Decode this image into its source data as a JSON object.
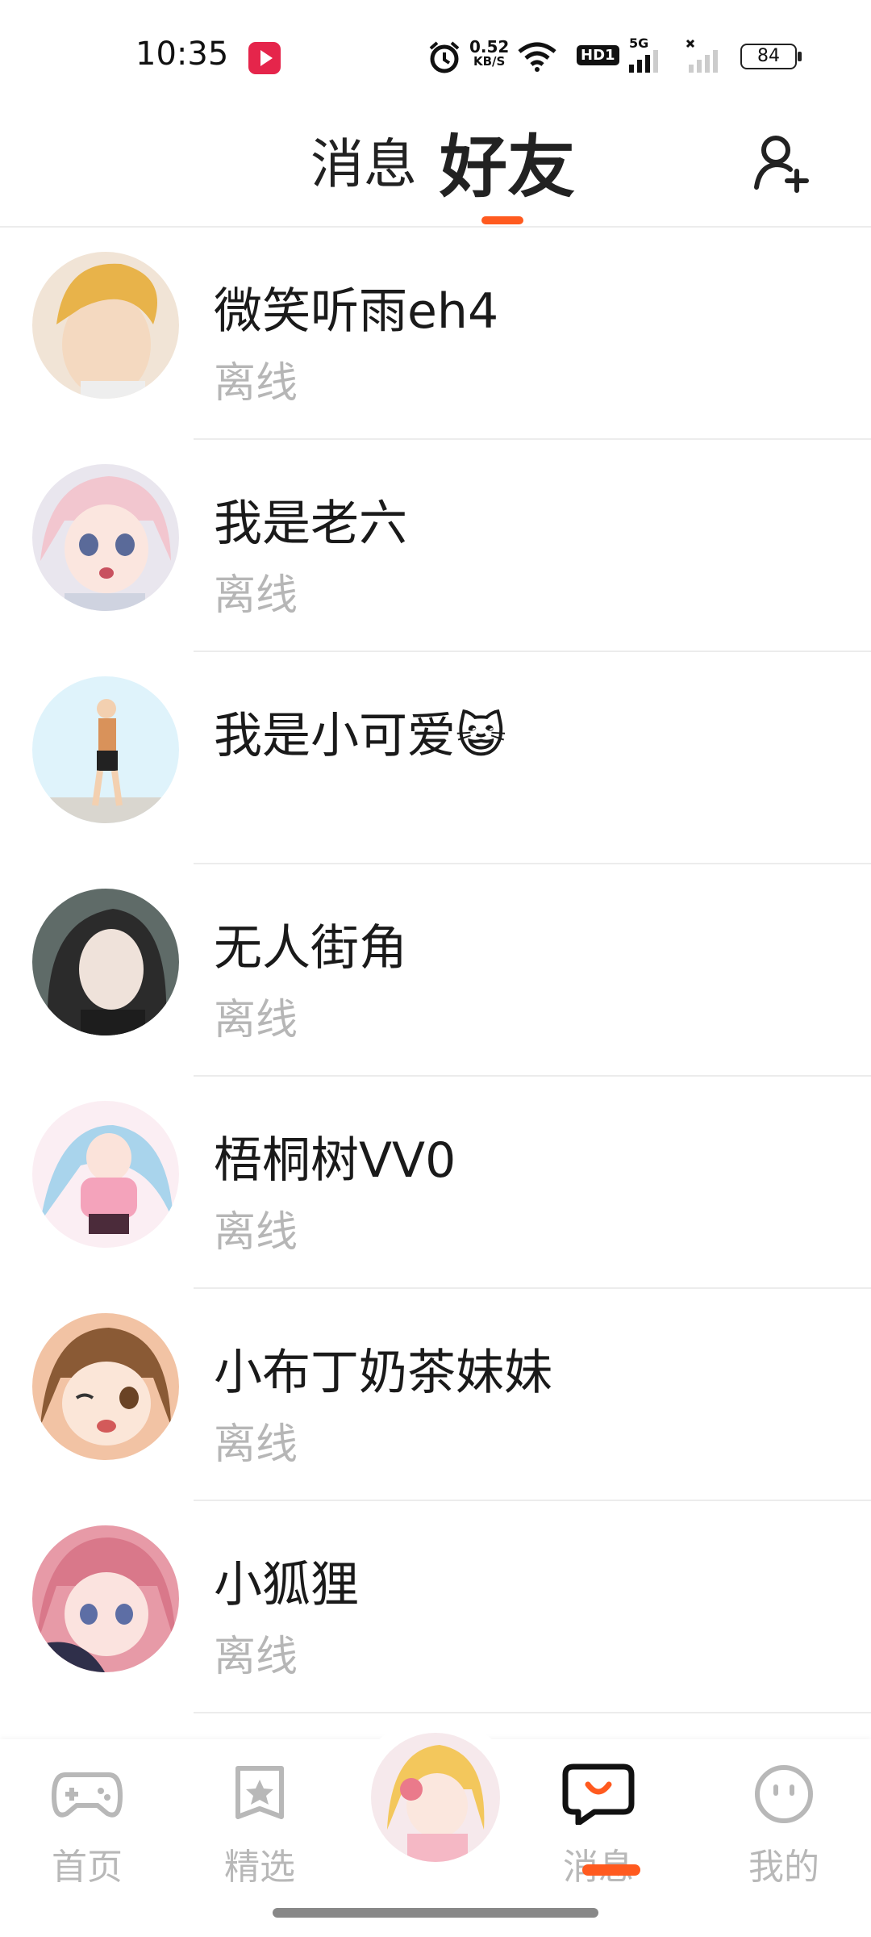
{
  "status_bar": {
    "time": "10:35",
    "net_speed_value": "0.52",
    "net_speed_unit": "KB/S",
    "hd_label": "HD1",
    "signal_5g_label": "5G",
    "battery": "84"
  },
  "header": {
    "tabs": [
      {
        "label": "消息",
        "active": false
      },
      {
        "label": "好友",
        "active": true
      }
    ],
    "add_friend_icon": "add-user-icon",
    "accent_color": "#ff5a1f"
  },
  "friends": [
    {
      "name": "微笑听雨eh4",
      "status": "离线",
      "avatar_color": "#f3d3a8"
    },
    {
      "name": "我是老六",
      "status": "离线",
      "avatar_color": "#f2d7dd"
    },
    {
      "name": "我是小可爱",
      "emoji": "😺",
      "status": "",
      "avatar_color": "#dff3fb"
    },
    {
      "name": "无人街角",
      "status": "离线",
      "avatar_color": "#5a6663"
    },
    {
      "name": "梧桐树VV0",
      "status": "离线",
      "avatar_color": "#f8d6e2"
    },
    {
      "name": "小布丁奶茶妹妹",
      "status": "离线",
      "avatar_color": "#f2c3a4"
    },
    {
      "name": "小狐狸",
      "status": "离线",
      "avatar_color": "#e79aa7"
    }
  ],
  "bottom_nav": {
    "items": [
      {
        "label": "首页",
        "icon": "gamepad-icon",
        "active": false
      },
      {
        "label": "精选",
        "icon": "star-bookmark-icon",
        "active": false
      },
      {
        "label": "",
        "icon": "center-avatar",
        "active": false
      },
      {
        "label": "消息",
        "icon": "chat-bubble-icon",
        "active": true
      },
      {
        "label": "我的",
        "icon": "face-icon",
        "active": false
      }
    ]
  }
}
